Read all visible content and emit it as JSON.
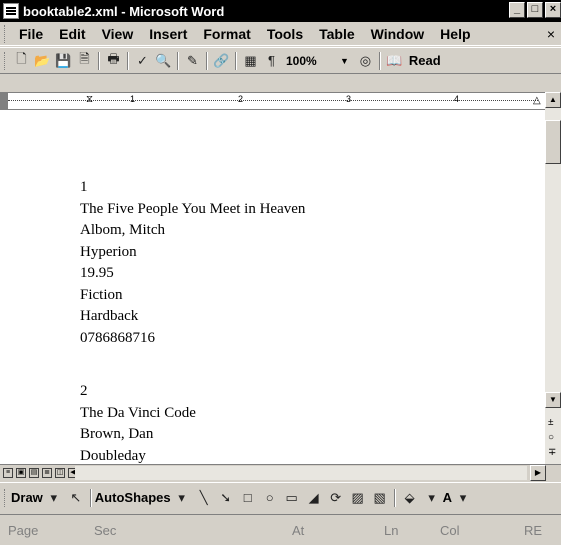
{
  "window": {
    "title": "booktable2.xml - Microsoft Word",
    "minimize_label": "_",
    "maximize_label": "□",
    "close_label": "×"
  },
  "menubar": {
    "items": [
      {
        "label": "File"
      },
      {
        "label": "Edit"
      },
      {
        "label": "View"
      },
      {
        "label": "Insert"
      },
      {
        "label": "Format"
      },
      {
        "label": "Tools"
      },
      {
        "label": "Table"
      },
      {
        "label": "Window"
      },
      {
        "label": "Help"
      }
    ],
    "close_doc_label": "×"
  },
  "toolbar": {
    "icons": [
      "new-document-icon",
      "open-folder-icon",
      "save-icon",
      "permission-icon",
      "print-icon",
      "spelling-icon",
      "research-icon",
      "format-painter-icon",
      "insert-hyperlink-icon",
      "document-map-icon",
      "show-formatting-icon"
    ],
    "zoom": "100%",
    "read_label": "Read"
  },
  "ruler": {
    "numbers": [
      "1",
      "2",
      "3",
      "4"
    ]
  },
  "document": {
    "records": [
      {
        "id": "1",
        "title": "The Five People You Meet in Heaven",
        "author": "Albom, Mitch",
        "publisher": "Hyperion",
        "price": "19.95",
        "genre": "Fiction",
        "format": "Hardback",
        "isbn": "0786868716"
      },
      {
        "id": "2",
        "title": "The Da Vinci Code",
        "author": "Brown, Dan",
        "publisher": "Doubleday",
        "price": "",
        "genre": "",
        "format": "",
        "isbn": ""
      }
    ]
  },
  "drawing_toolbar": {
    "draw_label": "Draw",
    "autoshapes_label": "AutoShapes",
    "font_color_label": "A"
  },
  "statusbar": {
    "page": "Page",
    "sec": "Sec",
    "at": "At",
    "ln": "Ln",
    "col": "Col",
    "rec": "RE"
  }
}
